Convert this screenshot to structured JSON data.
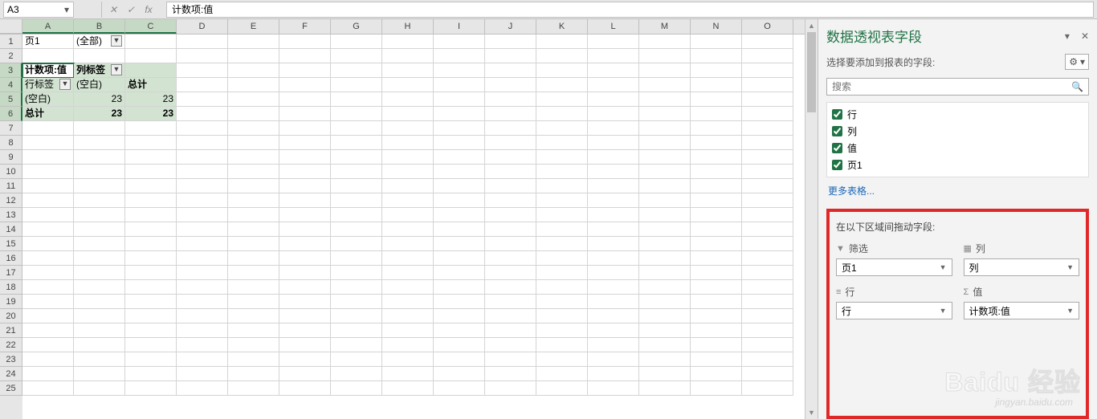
{
  "nameBox": {
    "value": "A3"
  },
  "formulaBar": {
    "value": "计数项:值"
  },
  "columns": [
    "A",
    "B",
    "C",
    "D",
    "E",
    "F",
    "G",
    "H",
    "I",
    "J",
    "K",
    "L",
    "M",
    "N",
    "O"
  ],
  "rowCount": 25,
  "selectedRows": [
    3,
    4,
    5,
    6
  ],
  "selectedCols": [
    "A",
    "B",
    "C"
  ],
  "cells": {
    "A1": "页1",
    "B1": "(全部)",
    "A3": "计数项:值",
    "B3": "列标签",
    "A4": "行标签",
    "B4": "(空白)",
    "C4": "总计",
    "A5": "(空白)",
    "B5": "23",
    "C5": "23",
    "A6": "总计",
    "B6": "23",
    "C6": "23"
  },
  "panel": {
    "title": "数据透视表字段",
    "subtitle": "选择要添加到报表的字段:",
    "searchPlaceholder": "搜索",
    "fields": [
      "行",
      "列",
      "值",
      "页1"
    ],
    "moreTables": "更多表格...",
    "dragLabel": "在以下区域间拖动字段:",
    "areas": {
      "filter": {
        "label": "筛选",
        "items": [
          "页1"
        ]
      },
      "columns": {
        "label": "列",
        "items": [
          "列"
        ]
      },
      "rows": {
        "label": "行",
        "items": [
          "行"
        ]
      },
      "values": {
        "label": "值",
        "items": [
          "计数项:值"
        ]
      }
    }
  },
  "watermark": {
    "main": "Baidu 经验",
    "sub": "jingyan.baidu.com"
  }
}
